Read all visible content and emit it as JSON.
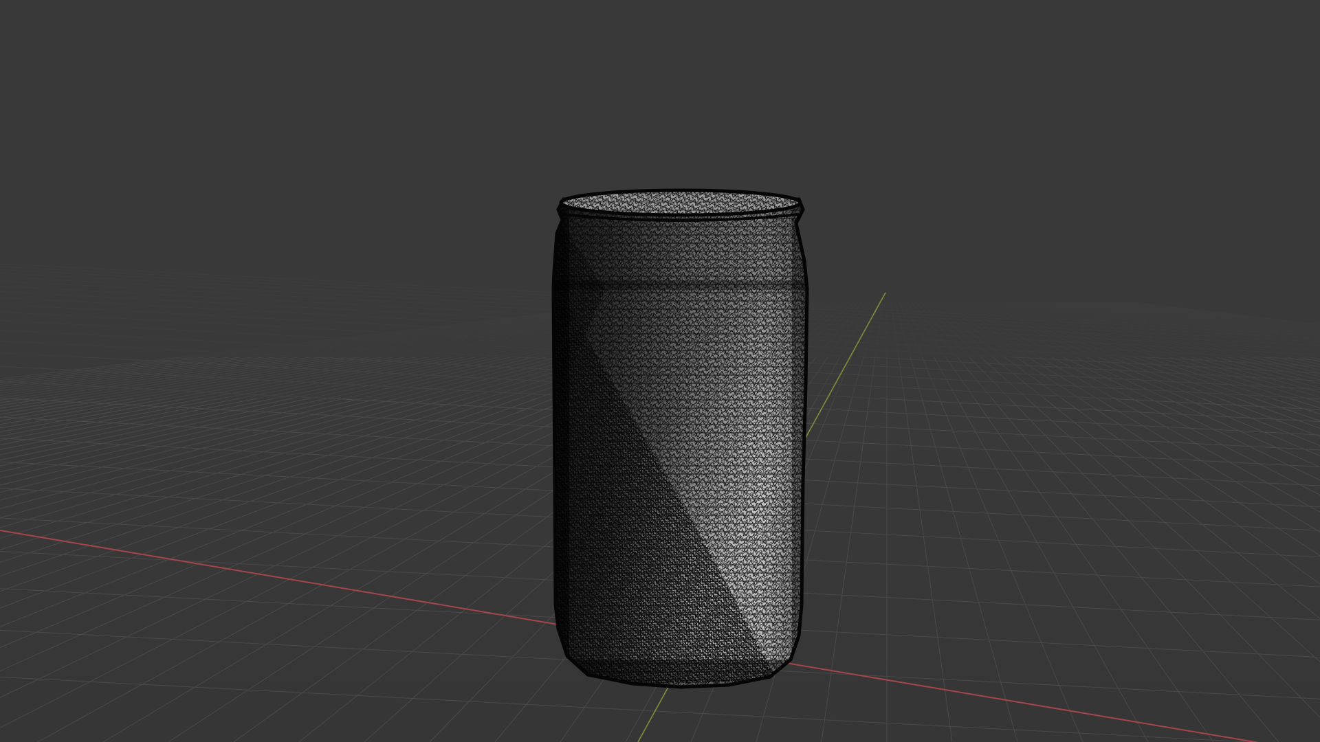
{
  "viewport": {
    "mode": "wireframe",
    "background_color": "#393939",
    "grid_color": "#4a4a4a",
    "grid_major_color": "#555555",
    "axes": {
      "x_axis_color": "#a5464b",
      "y_axis_color": "#7f8f3a",
      "x_axis_visible": true,
      "y_axis_visible": true
    },
    "object": {
      "kind": "can-mesh",
      "surface_color": "#b9b9b9",
      "wire_color": "#0a0a0a"
    }
  }
}
